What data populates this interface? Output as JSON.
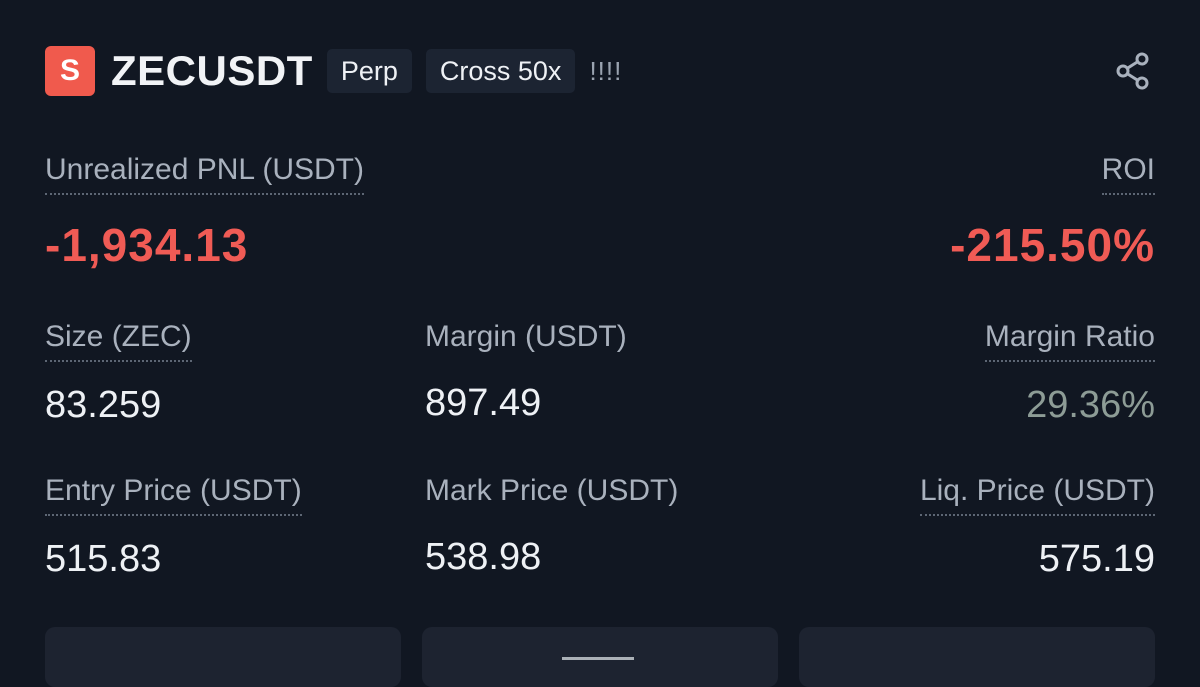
{
  "header": {
    "badge_letter": "S",
    "symbol": "ZECUSDT",
    "tags": [
      "Perp",
      "Cross 50x"
    ],
    "signal_bars": "!!!!",
    "share_icon": "share-icon",
    "badge_color": "#f05a4d"
  },
  "pnl": {
    "label": "Unrealized PNL (USDT)",
    "value": "-1,934.13",
    "color": "#f05b55"
  },
  "roi": {
    "label": "ROI",
    "value": "-215.50%"
  },
  "metrics": {
    "size": {
      "label": "Size (ZEC)",
      "value": "83.259"
    },
    "margin": {
      "label": "Margin (USDT)",
      "value": "897.49"
    },
    "margin_ratio": {
      "label": "Margin Ratio",
      "value": "29.36%"
    },
    "entry_price": {
      "label": "Entry Price (USDT)",
      "value": "515.83"
    },
    "mark_price": {
      "label": "Mark Price (USDT)",
      "value": "538.98"
    },
    "liq_price": {
      "label": "Liq. Price (USDT)",
      "value": "575.19"
    }
  }
}
